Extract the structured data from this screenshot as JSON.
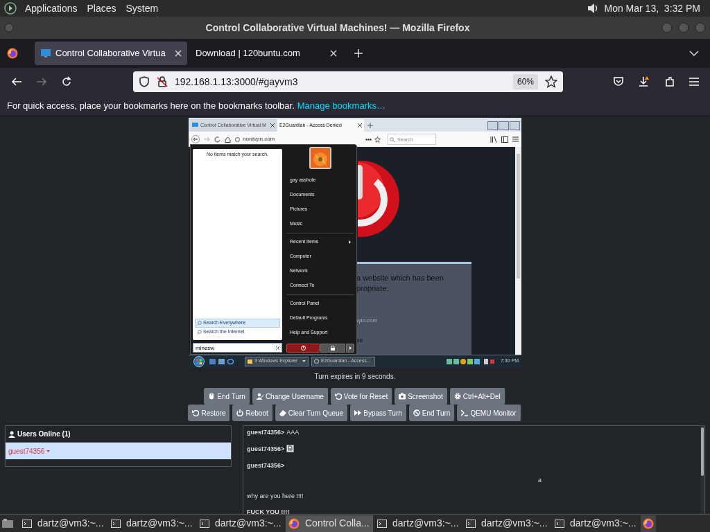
{
  "top_panel": {
    "menus": [
      "Applications",
      "Places",
      "System"
    ],
    "clock": "Mon Mar 13,  3:32 PM"
  },
  "window": {
    "title": "Control Collaborative Virtual Machines! — Mozilla Firefox"
  },
  "tabs": [
    {
      "label": "Control Collaborative Virtua",
      "selected": true
    },
    {
      "label": "Download | 120buntu.com",
      "selected": false
    }
  ],
  "address_bar": {
    "url": "192.168.1.13:3000/#gayvm3",
    "zoom": "60%"
  },
  "bookmarks_bar": {
    "text": "For quick access, place your bookmarks here on the bookmarks toolbar.",
    "link": "Manage bookmarks…"
  },
  "vm_screen": {
    "tabs": [
      {
        "label": "Control Collaborative Virtual M",
        "selected": false
      },
      {
        "label": "E2Guardian - Access Denied",
        "selected": true
      }
    ],
    "url": "nordvpn.com",
    "search_placeholder": "Search",
    "page_text": [
      "a website which has been",
      "propriate:",
      "vpn.com",
      "se"
    ],
    "start_menu": {
      "message": "No items match your search.",
      "search_options": [
        {
          "label": "Search Everywhere",
          "selected": true
        },
        {
          "label": "Search the Internet",
          "selected": false
        }
      ],
      "search_value": "minesw",
      "item_groups": [
        [
          {
            "label": "gay asshole",
            "submenu": false
          },
          {
            "label": "Documents",
            "submenu": false
          },
          {
            "label": "Pictures",
            "submenu": false
          },
          {
            "label": "Music",
            "submenu": false
          }
        ],
        [
          {
            "label": "Recent Items",
            "submenu": true
          },
          {
            "label": "Computer",
            "submenu": false
          },
          {
            "label": "Network",
            "submenu": false
          },
          {
            "label": "Connect To",
            "submenu": false
          }
        ],
        [
          {
            "label": "Control Panel",
            "submenu": false
          },
          {
            "label": "Default Programs",
            "submenu": false
          },
          {
            "label": "Help and Support",
            "submenu": false
          }
        ]
      ]
    },
    "taskbar": {
      "windows": [
        {
          "label": "3 Windows Explorer",
          "kind": "folder"
        },
        {
          "label": "E2Guardian - Access...",
          "kind": "browser"
        }
      ],
      "clock": "7:30 PM"
    }
  },
  "turn_status": "Turn expires in 9 seconds.",
  "vm_buttons": [
    [
      {
        "label": "End Turn",
        "kind": "mouse"
      },
      {
        "label": "Change Username",
        "kind": "user"
      },
      {
        "label": "Vote for Reset",
        "kind": "undo"
      },
      {
        "label": "Screenshot",
        "kind": "camera"
      },
      {
        "label": "Ctrl+Alt+Del",
        "kind": "gear"
      }
    ],
    [
      {
        "label": "Restore",
        "kind": "undo"
      },
      {
        "label": "Reboot",
        "kind": "power"
      },
      {
        "label": "Clear Turn Queue",
        "kind": "eraser"
      },
      {
        "label": "Bypass Turn",
        "kind": "forward"
      },
      {
        "label": "End Turn",
        "kind": "ban"
      },
      {
        "label": "QEMU Monitor",
        "kind": "terminal"
      }
    ]
  ],
  "users_online": {
    "title": "Users Online (1)",
    "users": [
      {
        "name": "guest74356",
        "selected": true
      }
    ]
  },
  "chat": {
    "messages": [
      {
        "kind": "inline",
        "user": "guest74356>",
        "text": "AAA"
      },
      {
        "kind": "attachment",
        "user": "guest74356>"
      },
      {
        "kind": "block",
        "user": "guest74356>",
        "body": "a"
      },
      {
        "kind": "plain",
        "text": "why are you here !!!!",
        "bold": false
      },
      {
        "kind": "plain",
        "text": "FUCK YOU !!!!",
        "bold": true
      }
    ]
  },
  "taskbar": {
    "items": [
      {
        "kind": "terminal",
        "label": "dartz@vm3:~...",
        "selected": false
      },
      {
        "kind": "terminal",
        "label": "dartz@vm3:~...",
        "selected": false
      },
      {
        "kind": "terminal",
        "label": "dartz@vm3:~...",
        "selected": false
      },
      {
        "kind": "browser",
        "label": "Control Colla...",
        "selected": true
      },
      {
        "kind": "terminal",
        "label": "dartz@vm3:~...",
        "selected": false
      },
      {
        "kind": "terminal",
        "label": "dartz@vm3:~...",
        "selected": false
      },
      {
        "kind": "terminal",
        "label": "dartz@vm3:~...",
        "selected": false
      },
      {
        "kind": "launcher",
        "selected": false
      }
    ]
  }
}
